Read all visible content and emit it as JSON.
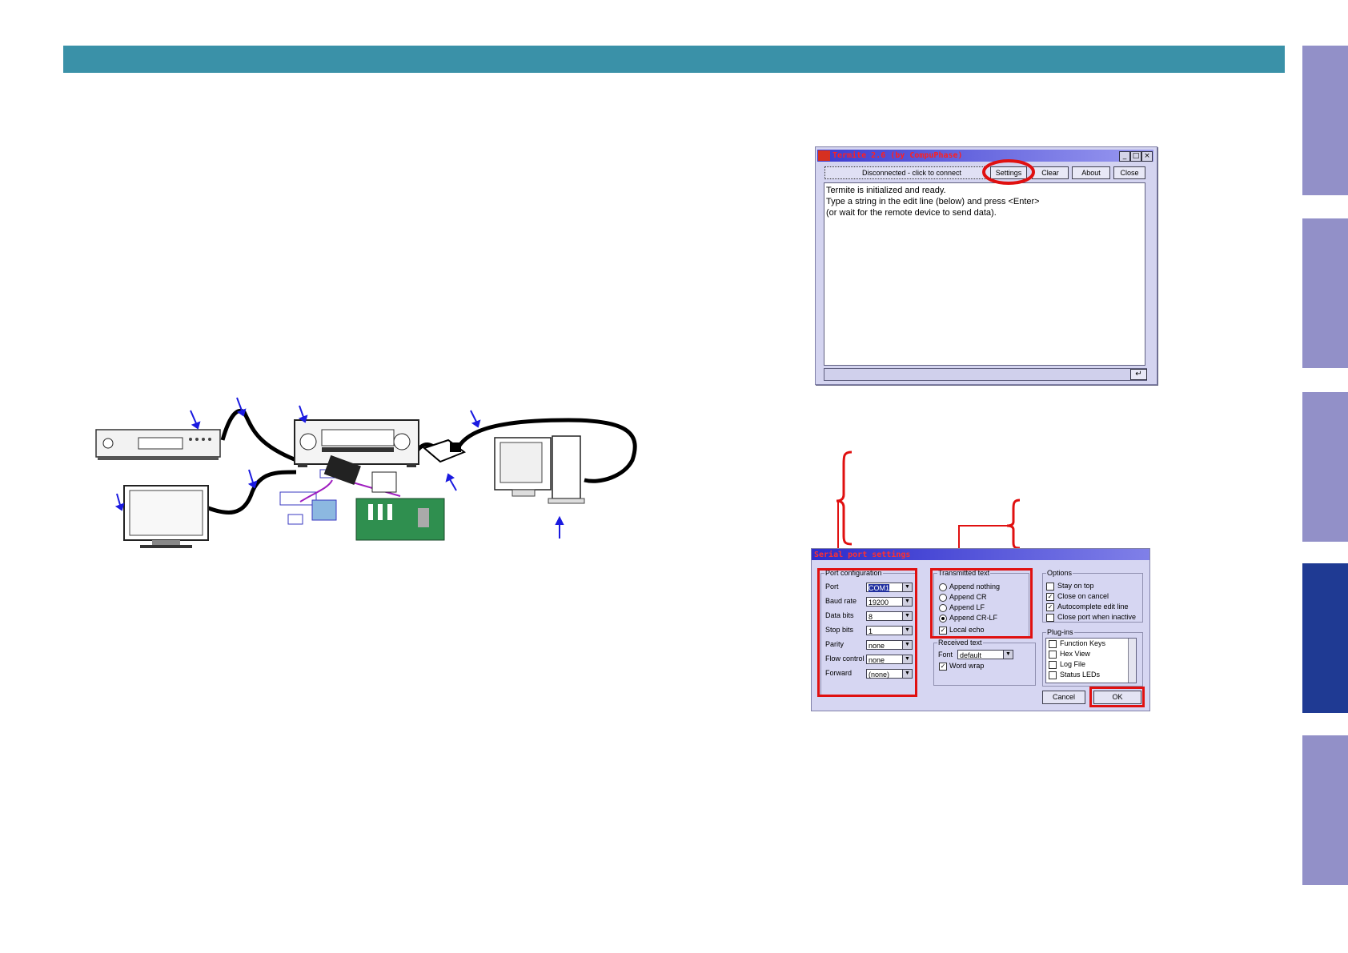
{
  "side_tabs": [
    {
      "active": false
    },
    {
      "active": false
    },
    {
      "active": false
    },
    {
      "active": true
    },
    {
      "active": false
    }
  ],
  "colors": {
    "header": "#3a91a8",
    "tab": "#9290c8",
    "tab_active": "#1f3a93",
    "highlight": "#e01010",
    "arrow": "#1a1ae0"
  },
  "termite": {
    "title": "Termite 2.6  (by CompuPhase)",
    "status": "Disconnected - click to connect",
    "buttons": {
      "settings": "Settings",
      "clear": "Clear",
      "about": "About",
      "close": "Close"
    },
    "lines": [
      "Termite is initialized and ready.",
      "Type a string in the edit line (below) and press <Enter>",
      "(or wait for the remote device to send data)."
    ],
    "enter_symbol": "↵"
  },
  "serial": {
    "title": "Serial port settings",
    "port_config": {
      "label": "Port configuration",
      "rows": [
        {
          "label": "Port",
          "value": "COM1"
        },
        {
          "label": "Baud rate",
          "value": "19200"
        },
        {
          "label": "Data bits",
          "value": "8"
        },
        {
          "label": "Stop bits",
          "value": "1"
        },
        {
          "label": "Parity",
          "value": "none"
        },
        {
          "label": "Flow control",
          "value": "none"
        },
        {
          "label": "Forward",
          "value": "(none)"
        }
      ]
    },
    "transmitted": {
      "label": "Transmitted text",
      "options": [
        "Append nothing",
        "Append CR",
        "Append LF",
        "Append CR-LF"
      ],
      "selected_index": 3,
      "local_echo": "Local echo"
    },
    "received": {
      "label": "Received text",
      "font_label": "Font",
      "font_value": "default",
      "word_wrap": "Word wrap"
    },
    "options": {
      "label": "Options",
      "items": [
        {
          "label": "Stay on top",
          "checked": false
        },
        {
          "label": "Close on cancel",
          "checked": true
        },
        {
          "label": "Autocomplete edit line",
          "checked": true
        },
        {
          "label": "Close port when inactive",
          "checked": false
        }
      ]
    },
    "plugins": {
      "label": "Plug-ins",
      "items": [
        "Function Keys",
        "Hex View",
        "Log File",
        "Status LEDs"
      ]
    },
    "cancel": "Cancel",
    "ok": "OK"
  }
}
